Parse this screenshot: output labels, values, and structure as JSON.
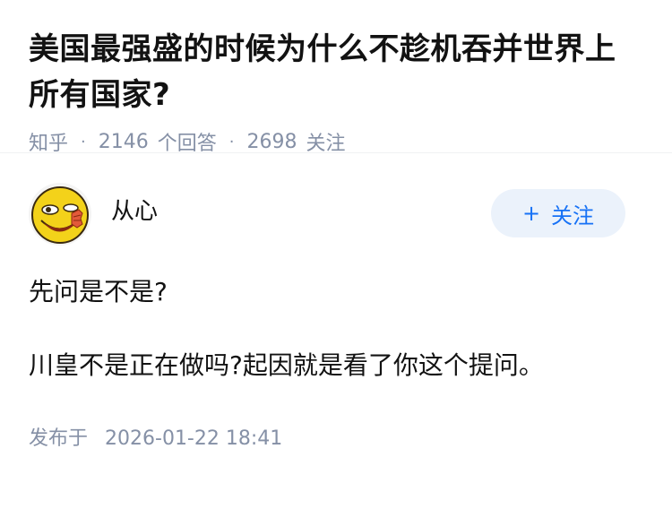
{
  "question": {
    "title": "美国最强盛的时候为什么不趁机吞并世界上所有国家?",
    "source": "知乎",
    "answer_count": "2146",
    "answer_label": "个回答",
    "follower_count": "2698",
    "follower_label": "关注"
  },
  "answer": {
    "author_name": "从心",
    "avatar_icon": "smiley-face-avatar-icon",
    "follow_button": {
      "icon": "plus-icon",
      "plus": "+",
      "label": "关注"
    },
    "paragraphs": [
      "先问是不是?",
      "川皇不是正在做吗?起因就是看了你这个提问。"
    ],
    "publish_label": "发布于",
    "publish_time": "2026-01-22 18:41"
  },
  "colors": {
    "text": "#121212",
    "meta": "#8590a6",
    "accent": "#1772f6",
    "button_bg": "#ebf2fb"
  }
}
